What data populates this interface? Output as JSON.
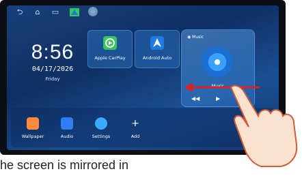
{
  "status": {
    "time": "8:56",
    "date": "04/17/2026",
    "day": "Friday"
  },
  "tiles": [
    {
      "label": "Apple CarPlay",
      "color": "#34c759"
    },
    {
      "label": "Android Auto",
      "color": "#1f7ae0"
    }
  ],
  "music": {
    "header": "Music",
    "label": "Music"
  },
  "dock": [
    {
      "label": "Wallpaper",
      "icon": "wallpaper-icon",
      "color": "#ff8a3d"
    },
    {
      "label": "Audio",
      "icon": "audio-icon",
      "color": "#2e7cf6"
    },
    {
      "label": "Settings",
      "icon": "settings-icon",
      "color": "#3aa9ff"
    },
    {
      "label": "Add",
      "icon": "add-icon",
      "color": "#ffffff"
    }
  ],
  "caption": "he screen is mirrored in"
}
